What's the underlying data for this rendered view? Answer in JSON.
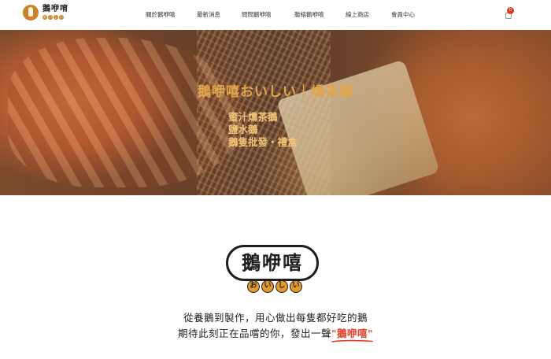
{
  "header": {
    "logo_text": "鵝咿唷",
    "logo_kana": [
      "お",
      "い",
      "し",
      "い"
    ],
    "cart_count": "0"
  },
  "nav": {
    "items": [
      {
        "label": "關於鵝咿嘻"
      },
      {
        "label": "最新消息"
      },
      {
        "label": "問問鵝咿嘻"
      },
      {
        "label": "聯絡鵝咿嘻"
      },
      {
        "label": "線上商店"
      },
      {
        "label": "會員中心"
      }
    ]
  },
  "hero": {
    "title": "鵝咿嘻おいしい｜燻茶鵝",
    "lines": [
      "蜜汁燻茶鵝",
      "鹽水鵝",
      "鵝隻批發・禮盒"
    ]
  },
  "brand": {
    "name": "鵝咿嘻",
    "kana": [
      "お",
      "い",
      "し",
      "い"
    ]
  },
  "tagline": {
    "line1": "從養鵝到製作，用心做出每隻都好吃的鵝",
    "line2_prefix": "期待此刻正在品嚐的你，發出一聲",
    "line2_highlight": "\"鵝咿嘻\""
  },
  "colors": {
    "accent": "#e39a2f",
    "highlight": "#e0432f",
    "hero_text": "#f3c477",
    "cart_badge": "#d43b2d"
  }
}
